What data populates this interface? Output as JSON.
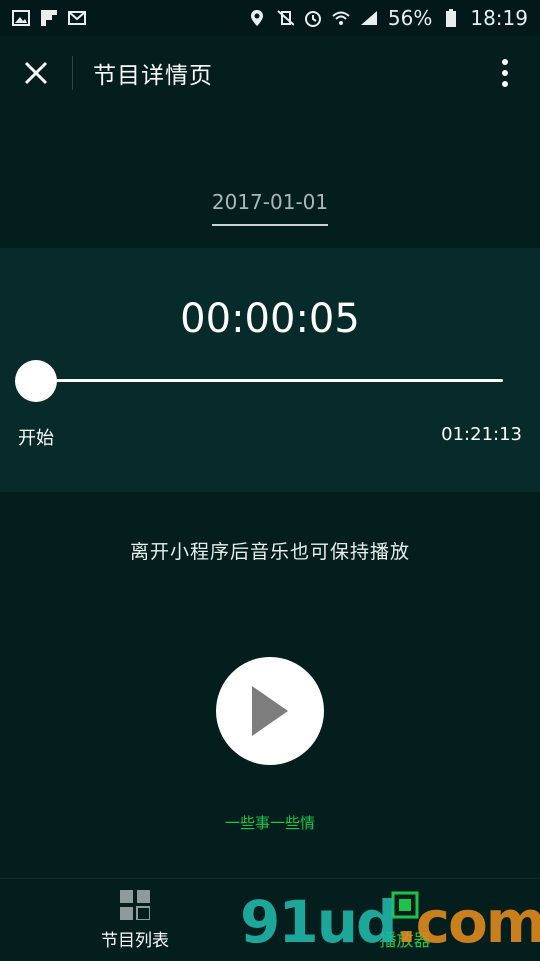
{
  "status_bar": {
    "battery": "56%",
    "time": "18:19"
  },
  "nav": {
    "title": "节目详情页"
  },
  "program": {
    "date": "2017-01-01",
    "current_time": "00:00:05",
    "start_label": "开始",
    "duration": "01:21:13",
    "progress": 0.001,
    "background_note": "离开小程序后音乐也可保持播放",
    "name": "一些事一些情"
  },
  "tabs": [
    {
      "label": "节目列表",
      "icon": "grid-icon"
    },
    {
      "label": "播放器",
      "icon": "player-icon",
      "active": true
    }
  ],
  "watermark": {
    "text_main": "91ud",
    "text_dot": ".com"
  },
  "colors": {
    "background": "#041d1d",
    "panel": "#072a2a",
    "accent_green": "#1ec34b"
  }
}
